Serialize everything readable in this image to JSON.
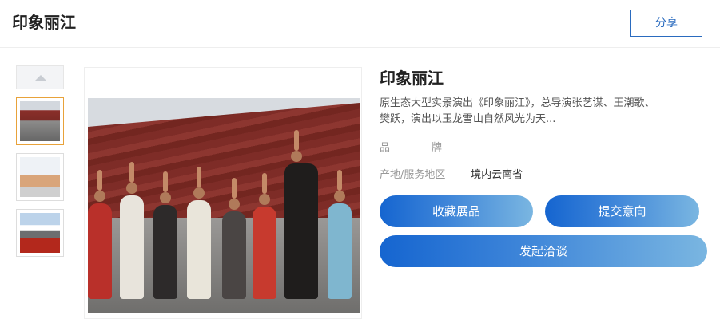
{
  "header": {
    "title": "印象丽江",
    "share_label": "分享"
  },
  "product": {
    "title": "印象丽江",
    "description": "原生态大型实景演出《印象丽江》，总导演张艺谋、王潮歌、 樊跃，演出以玉龙雪山自然风光为天...",
    "attributes": [
      {
        "label": "品　　　　牌",
        "value": ""
      },
      {
        "label": "产地/服务地区",
        "value": "境内云南省"
      }
    ]
  },
  "actions": {
    "favorite_label": "收藏展品",
    "intent_label": "提交意向",
    "negotiate_label": "发起洽谈"
  },
  "colors": {
    "accent": "#1565d0",
    "share_border": "#2a6bbf",
    "active_thumb": "#e8a23a"
  }
}
